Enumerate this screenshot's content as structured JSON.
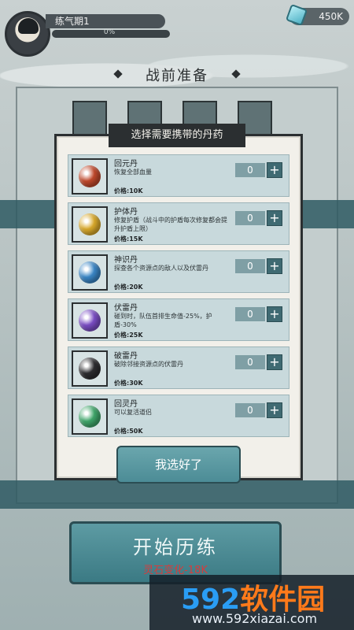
{
  "player": {
    "rank": "练气期1",
    "exp_text": "0%",
    "currency": "450K"
  },
  "prep": {
    "title": "战前准备",
    "start_button": "开始历练",
    "start_cost": "灵石变化-18K"
  },
  "modal": {
    "title": "选择需要携带的丹药",
    "confirm": "我选好了",
    "items": [
      {
        "name": "回元丹",
        "desc": "恢复全部血量",
        "price": "价格:10K",
        "qty": "0",
        "color": "#c0492c"
      },
      {
        "name": "护体丹",
        "desc": "修复护盾（战斗中的护盾每次修复都会提升护盾上限）",
        "price": "价格:15K",
        "qty": "0",
        "color": "#d9a92b"
      },
      {
        "name": "神识丹",
        "desc": "探查各个资源点的敌人以及伏雷丹",
        "price": "价格:20K",
        "qty": "0",
        "color": "#3a86c6"
      },
      {
        "name": "伏雷丹",
        "desc": "碰到时，队伍首排生命值-25%，护盾-30%",
        "price": "价格:25K",
        "qty": "0",
        "color": "#7a4dc4"
      },
      {
        "name": "破雷丹",
        "desc": "破除邻接资源点的伏雷丹",
        "price": "价格:30K",
        "qty": "0",
        "color": "#2d2d30"
      },
      {
        "name": "回灵丹",
        "desc": "可以复活道侣",
        "price": "价格:50K",
        "qty": "0",
        "color": "#3fa66a"
      }
    ]
  },
  "watermark": {
    "brand_num": "592",
    "brand_text": "软件园",
    "url": "www.592xiazai.com"
  }
}
